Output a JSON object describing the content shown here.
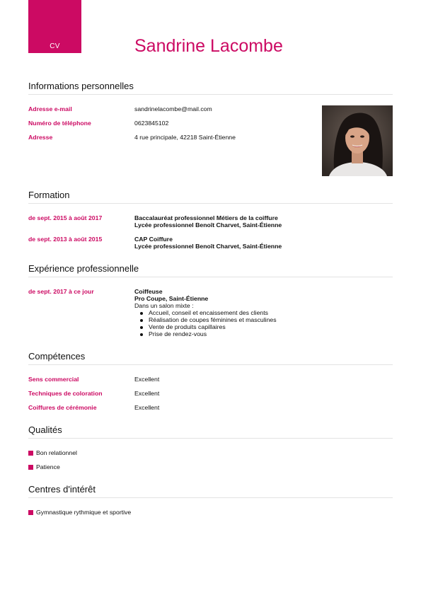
{
  "badge": "CV",
  "name": "Sandrine Lacombe",
  "personal": {
    "title": "Informations personnelles",
    "rows": [
      {
        "label": "Adresse e-mail",
        "value": "sandrinelacombe@mail.com"
      },
      {
        "label": "Numéro de téléphone",
        "value": "0623845102"
      },
      {
        "label": "Adresse",
        "value": "4 rue principale, 42218 Saint-Étienne"
      }
    ]
  },
  "education": {
    "title": "Formation",
    "items": [
      {
        "dates": "de sept. 2015 à août 2017",
        "degree": "Baccalauréat professionnel Métiers de la coiffure",
        "school": "Lycée professionnel Benoît Charvet, Saint-Étienne"
      },
      {
        "dates": "de sept. 2013 à août 2015",
        "degree": "CAP Coiffure",
        "school": "Lycée professionnel Benoît Charvet, Saint-Étienne"
      }
    ]
  },
  "experience": {
    "title": "Expérience professionnelle",
    "items": [
      {
        "dates": "de sept. 2017 à ce jour",
        "role": "Coiffeuse",
        "company": "Pro Coupe, Saint-Étienne",
        "intro": "Dans un salon mixte :",
        "bullets": [
          "Accueil, conseil et encaissement des clients",
          "Réalisation de coupes féminines et masculines",
          "Vente de produits capillaires",
          "Prise de rendez-vous"
        ]
      }
    ]
  },
  "skills": {
    "title": "Compétences",
    "rows": [
      {
        "label": "Sens commercial",
        "value": "Excellent"
      },
      {
        "label": "Techniques de coloration",
        "value": "Excellent"
      },
      {
        "label": "Coiffures de cérémonie",
        "value": "Excellent"
      }
    ]
  },
  "qualities": {
    "title": "Qualités",
    "items": [
      "Bon relationnel",
      "Patience"
    ]
  },
  "interests": {
    "title": "Centres d'intérêt",
    "items": [
      "Gymnastique rythmique et sportive"
    ]
  },
  "colors": {
    "accent": "#cc0a63",
    "text": "#111111",
    "divider": "#e3e3e3"
  }
}
